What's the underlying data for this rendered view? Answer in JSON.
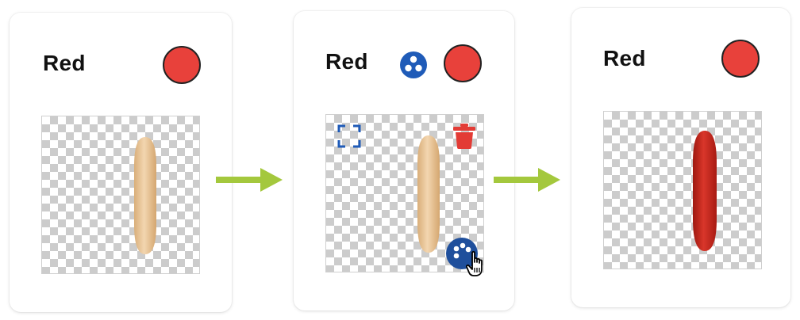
{
  "colors": {
    "swatch_red": "#e8413b",
    "accent_blue": "#1f5bb8",
    "delete_red": "#e33b35",
    "arrow_green": "#a4c83d",
    "wood_light": "#f1cfa4",
    "wood_dark": "#d9ae79",
    "stick_red": "#c8251c"
  },
  "steps": [
    {
      "color_name": "Red",
      "state": "original"
    },
    {
      "color_name": "Red",
      "state": "editing"
    },
    {
      "color_name": "Red",
      "state": "recolored"
    }
  ],
  "icons": {
    "palette": "palette-icon",
    "focus": "focus-frame-icon",
    "trash": "trash-icon",
    "recolor": "recolor-palette-icon",
    "cursor": "hand-pointer-icon",
    "arrow": "arrow-right-icon"
  }
}
